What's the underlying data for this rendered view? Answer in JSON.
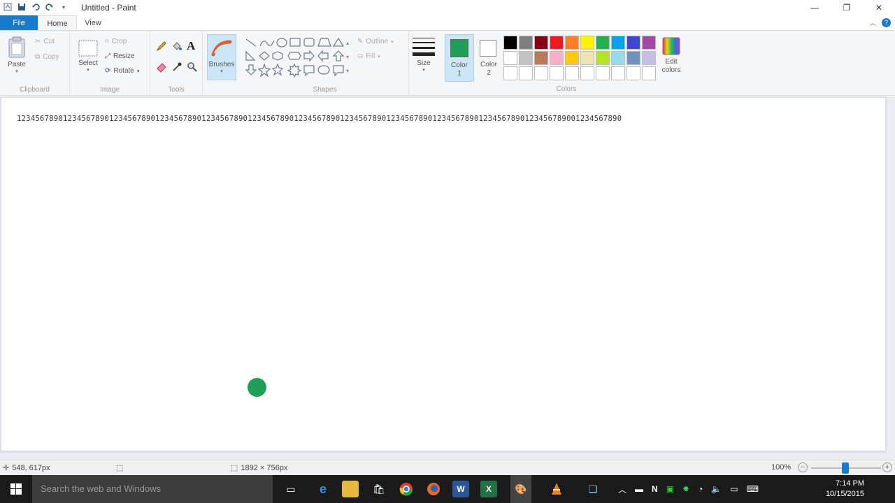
{
  "window": {
    "title": "Untitled - Paint",
    "controls": [
      "minimize",
      "restore",
      "close"
    ]
  },
  "tabs": [
    "File",
    "Home",
    "View"
  ],
  "ribbon": {
    "clipboard": {
      "group": "Clipboard",
      "paste": "Paste",
      "cut": "Cut",
      "copy": "Copy"
    },
    "image": {
      "group": "Image",
      "select": "Select",
      "crop": "Crop",
      "resize": "Resize",
      "rotate": "Rotate"
    },
    "tools": {
      "group": "Tools"
    },
    "brushes": {
      "label": "Brushes"
    },
    "shapes": {
      "group": "Shapes",
      "outline": "Outline",
      "fill": "Fill"
    },
    "size": {
      "label": "Size"
    },
    "colors": {
      "group": "Colors",
      "color1_label": "Color\n1",
      "color2_label": "Color\n2",
      "color1_value": "#1f9e57",
      "color2_value": "#ffffff",
      "edit_colors": "Edit\ncolors",
      "palette": [
        "#000000",
        "#7f7f7f",
        "#880015",
        "#ed1c24",
        "#ff7f27",
        "#fff200",
        "#22b14c",
        "#00a2e8",
        "#3f48cc",
        "#a349a4",
        "#ffffff",
        "#c3c3c3",
        "#b97a57",
        "#ffaec9",
        "#ffc90e",
        "#efe4b0",
        "#b5e61d",
        "#99d9ea",
        "#7092be",
        "#c8bfe7",
        "#ffffff",
        "#ffffff",
        "#ffffff",
        "#ffffff",
        "#ffffff",
        "#ffffff",
        "#ffffff",
        "#ffffff",
        "#ffffff",
        "#ffffff"
      ]
    }
  },
  "canvas": {
    "text": "12345678901234567890123456789012345678901234567890123456789012345678901234567890123456789012345678901234567890123456789001234567890",
    "dot_color": "#1f9e57"
  },
  "status": {
    "cursor_pos": "548, 617px",
    "image_size": "1892 × 756px",
    "zoom": "100%"
  },
  "taskbar": {
    "search_placeholder": "Search the web and Windows",
    "time": "7:14 PM",
    "date": "10/15/2015"
  }
}
